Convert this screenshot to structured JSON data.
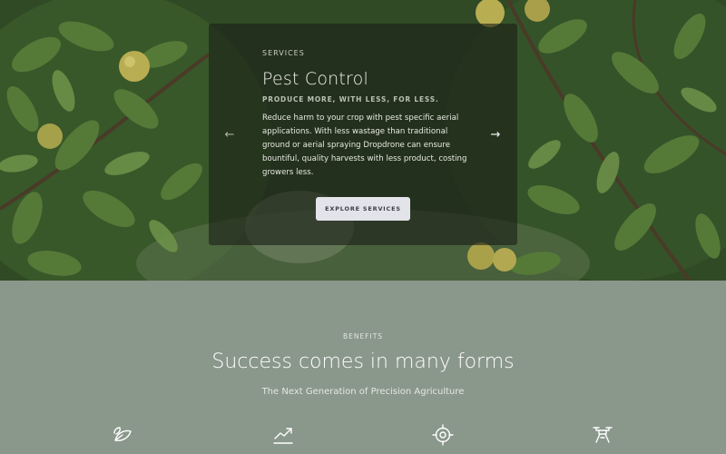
{
  "hero": {
    "card": {
      "eyebrow": "SERVICES",
      "title": "Pest Control",
      "subtitle": "PRODUCE MORE, WITH LESS, FOR LESS.",
      "body": "Reduce harm to your crop with pest specific aerial applications. With less wastage than traditional ground or aerial spraying Dropdrone can ensure bountiful, quality harvests with less product, costing growers less.",
      "prev_arrow": "←",
      "next_arrow": "→",
      "cta_label": "EXPLORE SERVICES"
    }
  },
  "benefits": {
    "eyebrow": "BENEFITS",
    "title": "Success comes in many forms",
    "subtitle": "The Next Generation of Precision Agriculture",
    "icons": [
      "leaf-icon",
      "trend-chart-icon",
      "target-icon",
      "drone-icon"
    ]
  },
  "colors": {
    "benefits_bg": "#8a978b",
    "card_bg": "rgba(28,32,24,0.62)",
    "cta_bg": "#e3e3ea"
  }
}
